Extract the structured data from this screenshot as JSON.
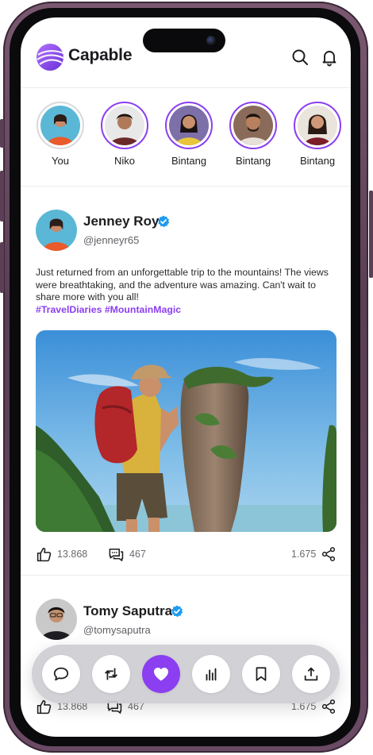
{
  "app": {
    "title": "Capable"
  },
  "colors": {
    "accent": "#8b3ff1",
    "verified": "#1d9bf0"
  },
  "header": {
    "icons": [
      "search-icon",
      "bell-icon"
    ]
  },
  "stories": [
    {
      "name": "You"
    },
    {
      "name": "Niko"
    },
    {
      "name": "Bintang"
    },
    {
      "name": "Bintang"
    },
    {
      "name": "Bintang"
    }
  ],
  "post": {
    "author": "Jenney Roy",
    "handle": "@jenneyr65",
    "text": "Just returned from an unforgettable trip to the mountains! The views were breathtaking, and the adventure was amazing. Can't wait to share more with you all!",
    "hashtags": "#TravelDiaries #MountainMagic",
    "likes": "13.868",
    "comments": "467",
    "shares": "1.675"
  },
  "post2": {
    "author": "Tomy Saputra",
    "handle": "@tomysaputra",
    "likes": "13.868",
    "comments": "467",
    "shares": "1.675"
  },
  "bottom_bar": {
    "buttons": [
      "comment-icon",
      "repost-icon",
      "heart-icon",
      "stats-icon",
      "bookmark-icon",
      "share-upload-icon"
    ],
    "active": "heart-icon"
  }
}
